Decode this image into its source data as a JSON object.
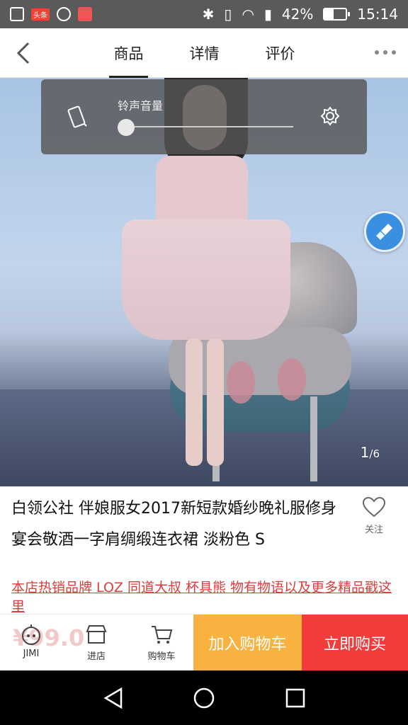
{
  "status_bar": {
    "battery_percent": "42%",
    "time": "15:14",
    "badge": "头条"
  },
  "nav": {
    "tabs": [
      "商品",
      "详情",
      "评价"
    ],
    "active_tab": 0
  },
  "volume_overlay": {
    "label": "铃声音量",
    "level": 0
  },
  "gallery": {
    "current": "1",
    "total": "6"
  },
  "product": {
    "title": "白领公社 伴娘服女2017新短款婚纱晚礼服修身宴会敬酒一字肩绸缎连衣裙 淡粉色 S",
    "follow_label": "关注",
    "promo": " 本店热销品牌 LOZ 同道大叔 杯具熊 物有物语以及更多精品戳这里"
  },
  "bottom_bar": {
    "price_ghost": "¥99.0",
    "jimi_label": "JIMI",
    "shop_label": "进店",
    "cart_label": "购物车",
    "add_to_cart": "加入购物车",
    "buy_now": "立即购买"
  },
  "colors": {
    "add_to_cart_bg": "#f9b140",
    "buy_now_bg": "#f23c3c",
    "promo_text": "#e03b3b",
    "float_button": "#3b8fe0"
  }
}
